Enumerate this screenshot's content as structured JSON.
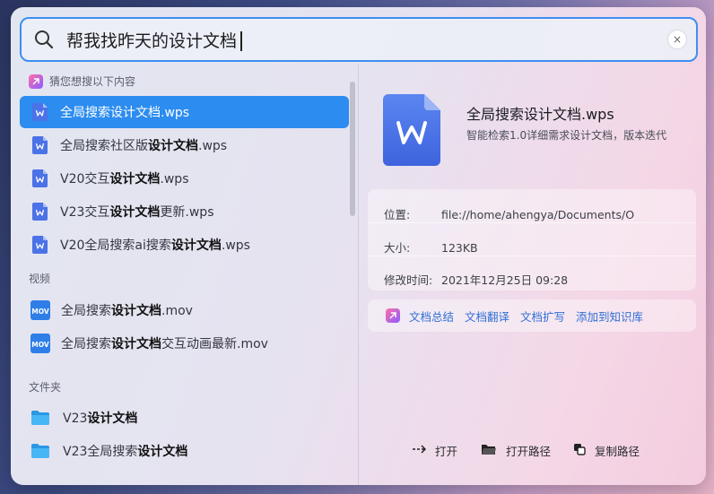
{
  "search": {
    "query": "帮我找昨天的设计文档",
    "clear_label": "×"
  },
  "colors": {
    "accent": "#2c8cf0",
    "wps_blue": "#4b72e6",
    "folder_blue": "#33a7f0"
  },
  "sections": {
    "suggest_header": "猜您想搜以下内容",
    "video_header": "视频",
    "folder_header": "文件夹"
  },
  "docs": [
    {
      "pre": "全局搜索设计文档.wps",
      "bold": "",
      "post": "",
      "icon": "wps-doc-icon"
    },
    {
      "pre": "全局搜索社区版",
      "bold": "设计文档",
      "post": ".wps",
      "icon": "wps-doc-icon"
    },
    {
      "pre": "V20交互",
      "bold": "设计文档",
      "post": ".wps",
      "icon": "wps-doc-icon"
    },
    {
      "pre": "V23交互",
      "bold": "设计文档",
      "post": "更新.wps",
      "icon": "wps-doc-icon"
    },
    {
      "pre": "V20全局搜索ai搜索",
      "bold": "设计文档",
      "post": ".wps",
      "icon": "wps-doc-icon"
    }
  ],
  "videos": [
    {
      "pre": "全局搜索",
      "bold": "设计文档",
      "post": ".mov",
      "icon_text": "MOV"
    },
    {
      "pre": "全局搜索",
      "bold": "设计文档",
      "post": "交互动画最新.mov",
      "icon_text": "MOV"
    }
  ],
  "folders": [
    {
      "pre": "V23",
      "bold": "设计文档",
      "post": ""
    },
    {
      "pre": "V23全局搜索",
      "bold": "设计文档",
      "post": ""
    }
  ],
  "preview": {
    "title": "全局搜索设计文档.wps",
    "subtitle": "智能检索1.0详细需求设计文档，版本迭代",
    "location_label": "位置:",
    "location_value": "file://home/ahengya/Documents/O",
    "size_label": "大小:",
    "size_value": "123KB",
    "modified_label": "修改时间:",
    "modified_value": "2021年12月25日  09:28"
  },
  "ai_actions": [
    "文档总结",
    "文档翻译",
    "文档扩写",
    "添加到知识库"
  ],
  "bottom_actions": {
    "open": "打开",
    "open_path": "打开路径",
    "copy_path": "复制路径"
  }
}
